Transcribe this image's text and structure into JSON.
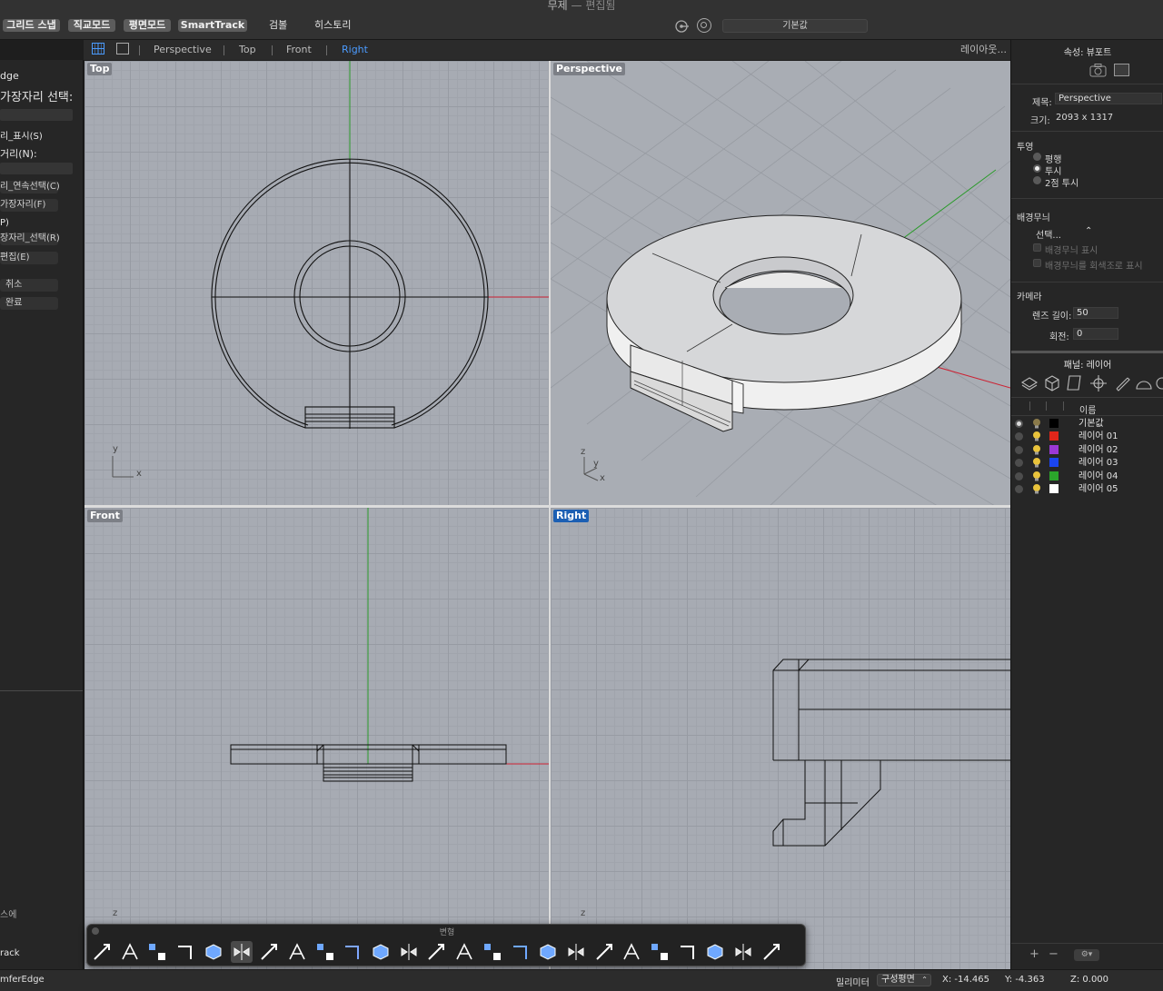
{
  "window": {
    "title": "무제",
    "title_sep": "—",
    "title_state": "편집됨"
  },
  "topbar": {
    "grid_snap": "그리드 스냅",
    "ortho": "직교모드",
    "planar": "평면모드",
    "smarttrack": "SmartTrack",
    "gumball": "검볼",
    "history": "히스토리",
    "cplane_value": "기본값"
  },
  "viewport_tabs": {
    "items": [
      "Perspective",
      "Top",
      "Front",
      "Right"
    ],
    "active": "Right",
    "layout_label": "레이아웃..."
  },
  "command": {
    "name_fragment": "dge",
    "prompt": "가장자리 선택:",
    "show_edges": "리_표시(S)",
    "distance": "거리(N):",
    "chain_select": "리_연속선택(C)",
    "edge_f": "가장자리(F)",
    "option_p": "P)",
    "edge_select_r": "장자리_선택(R)",
    "edit_e": "편집(E)",
    "cancel": "취소",
    "done": "완료",
    "history_fragment": "스에",
    "status_fragment": "rack",
    "last_command": "mferEdge"
  },
  "viewports": {
    "top": "Top",
    "perspective": "Perspective",
    "front": "Front",
    "right": "Right",
    "axis_y": "y",
    "axis_x": "x",
    "axis_z": "z"
  },
  "properties": {
    "header": "속성: 뷰포트",
    "title_label": "제목:",
    "title_value": "Perspective",
    "size_label": "크기:",
    "size_value": "2093 x 1317",
    "projection_heading": "투영",
    "projection_options": [
      "평행",
      "투시",
      "2점 투시"
    ],
    "projection_selected": "투시",
    "wallpaper_heading": "배경무늬",
    "wallpaper_select": "선택...",
    "wallpaper_show": "배경무늬 표시",
    "wallpaper_gray": "배경무늬를 회색조로 표시",
    "camera_heading": "카메라",
    "lens_label": "렌즈 길이:",
    "lens_value": "50",
    "rotation_label": "회전:",
    "rotation_value": "0"
  },
  "layers": {
    "header": "패널: 레이어",
    "name_column": "이름",
    "items": [
      {
        "name": "기본값",
        "color": "#000000",
        "current": true
      },
      {
        "name": "레이어 01",
        "color": "#e0261a",
        "current": false
      },
      {
        "name": "레이어 02",
        "color": "#9b38d6",
        "current": false
      },
      {
        "name": "레이어 03",
        "color": "#1b45f0",
        "current": false
      },
      {
        "name": "레이어 04",
        "color": "#2ba52b",
        "current": false
      },
      {
        "name": "레이어 05",
        "color": "#ffffff",
        "current": false
      }
    ],
    "add": "+",
    "remove": "−"
  },
  "toolbar": {
    "title": "변형"
  },
  "status": {
    "units": "밀리미터",
    "cplane": "구성평면",
    "x": "X: -14.465",
    "y": "Y: -4.363",
    "z": "Z: 0.000"
  },
  "colors": {
    "active_tab": "#4b9bff",
    "active_viewport_label": "#1c5fb3",
    "viewport_bg": "#a7abb3"
  }
}
